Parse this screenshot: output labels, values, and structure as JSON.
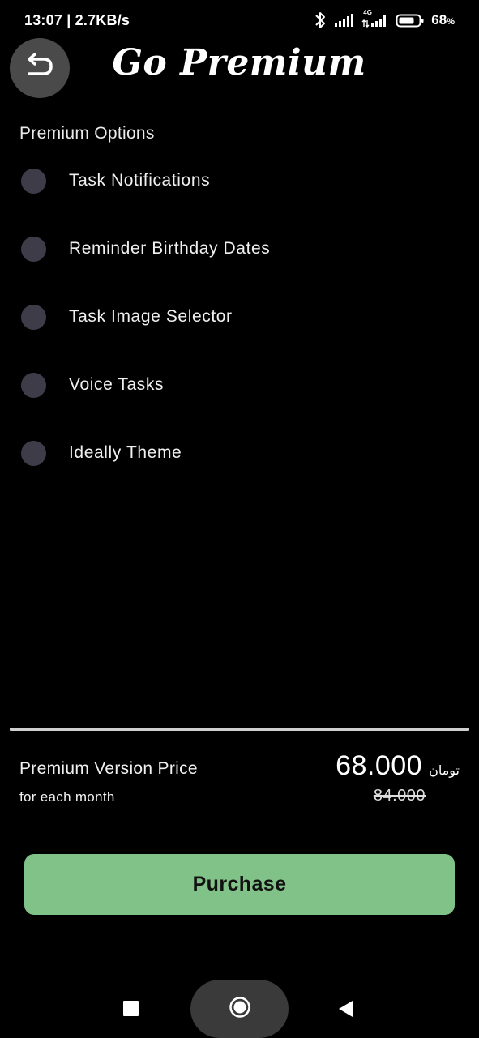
{
  "status_bar": {
    "time_speed": "13:07 | 2.7KB/s",
    "battery_percent": "68",
    "battery_unit": "%",
    "network_label": "4G",
    "icons": [
      "bluetooth-icon",
      "signal-icon",
      "signal-4g-icon",
      "battery-icon"
    ]
  },
  "header": {
    "title": "Go Premium",
    "back_icon": "undo-arrow-icon"
  },
  "options": {
    "section_title": "Premium Options",
    "items": [
      {
        "label": "Task Notifications",
        "selected": false
      },
      {
        "label": "Reminder Birthday Dates",
        "selected": false
      },
      {
        "label": "Task Image Selector",
        "selected": false
      },
      {
        "label": "Voice Tasks",
        "selected": false
      },
      {
        "label": "Ideally Theme",
        "selected": false
      }
    ]
  },
  "price": {
    "label": "Premium Version Price",
    "period": "for each month",
    "current": "68.000",
    "currency": "تومان",
    "old": "84.000"
  },
  "purchase": {
    "label": "Purchase",
    "color": "#80c287"
  },
  "nav_bar": {
    "icons": [
      "recents-square-icon",
      "home-circle-icon",
      "back-triangle-icon"
    ]
  }
}
